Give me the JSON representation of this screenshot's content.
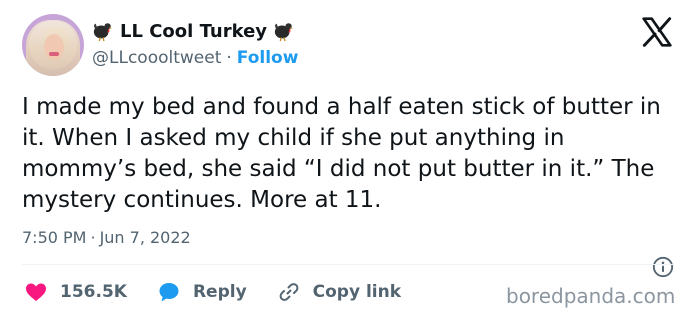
{
  "author": {
    "name": "LL Cool Turkey",
    "handle": "@LLcoooltweet",
    "separator": "·",
    "follow_label": "Follow"
  },
  "tweet": {
    "text": "I made my bed and found a half eaten stick of butter in it. When I asked my child if she put anything in mommy’s bed, she said “I did not put butter in it.” The mystery continues. More at 11.",
    "time": "7:50 PM",
    "separator": "·",
    "date": "Jun 7, 2022"
  },
  "actions": {
    "like_count": "156.5K",
    "reply_label": "Reply",
    "copy_link_label": "Copy link"
  },
  "watermark": "boredpanda.com",
  "colors": {
    "follow": "#1d9bf0",
    "like": "#f91880",
    "reply": "#1d9bf0",
    "secondary_text": "#536471"
  },
  "icons": {
    "turkey": "turkey-emoji-icon",
    "platform": "x-logo-icon",
    "like": "heart-icon",
    "reply": "speech-bubble-icon",
    "copy_link": "link-icon",
    "info": "info-icon"
  }
}
